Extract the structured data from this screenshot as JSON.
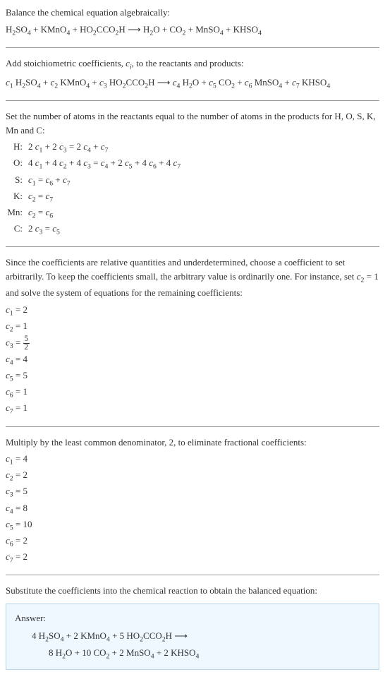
{
  "intro1": "Balance the chemical equation algebraically:",
  "eq1_a": "H",
  "eq1_b": "2",
  "eq1_c": "SO",
  "eq1_d": "4",
  "eq1_e": " + KMnO",
  "eq1_f": "4",
  "eq1_g": " + HO",
  "eq1_h": "2",
  "eq1_i": "CCO",
  "eq1_j": "2",
  "eq1_k": "H ",
  "eq1_arrow": "⟶",
  "eq1_l": " H",
  "eq1_m": "2",
  "eq1_n": "O + CO",
  "eq1_o": "2",
  "eq1_p": " + MnSO",
  "eq1_q": "4",
  "eq1_r": " + KHSO",
  "eq1_s": "4",
  "intro2a": "Add stoichiometric coefficients, ",
  "intro2b": "c",
  "intro2c": "i",
  "intro2d": ", to the reactants and products:",
  "eq2_a": "c",
  "eq2_b": "1",
  "eq2_c": " H",
  "eq2_d": "2",
  "eq2_e": "SO",
  "eq2_f": "4",
  "eq2_g": " + ",
  "eq2_h": "c",
  "eq2_i": "2",
  "eq2_j": " KMnO",
  "eq2_k": "4",
  "eq2_l": " + ",
  "eq2_m": "c",
  "eq2_n": "3",
  "eq2_o": " HO",
  "eq2_p": "2",
  "eq2_q": "CCO",
  "eq2_r": "2",
  "eq2_s": "H ",
  "eq2_arrow": "⟶",
  "eq2_t": " ",
  "eq2_u": "c",
  "eq2_v": "4",
  "eq2_w": " H",
  "eq2_x": "2",
  "eq2_y": "O + ",
  "eq2_z": "c",
  "eq2_aa": "5",
  "eq2_ab": " CO",
  "eq2_ac": "2",
  "eq2_ad": " + ",
  "eq2_ae": "c",
  "eq2_af": "6",
  "eq2_ag": " MnSO",
  "eq2_ah": "4",
  "eq2_ai": " + ",
  "eq2_aj": "c",
  "eq2_ak": "7",
  "eq2_al": " KHSO",
  "eq2_am": "4",
  "intro3": "Set the number of atoms in the reactants equal to the number of atoms in the products for H, O, S, K, Mn and C:",
  "atoms": [
    {
      "label": "H:",
      "c": "c",
      "s1": "1",
      "t1": " + 2 ",
      "s2": "3",
      "t2": " = 2 ",
      "s3": "4",
      "t3": " + ",
      "s4": "7",
      "eq_pre": "2 "
    },
    {
      "label": "O:",
      "c": "c",
      "s1": "1",
      "t1": " + 4 ",
      "s2": "2",
      "t2": " + 4 ",
      "s3": "3",
      "t3": " = ",
      "s4": "4",
      "t4": " + 2 ",
      "s5": "5",
      "t5": " + 4 ",
      "s6": "6",
      "t6": " + 4 ",
      "s7": "7",
      "eq_pre": "4 "
    },
    {
      "label": "S:",
      "c": "c",
      "s1": "1",
      "t1": " = ",
      "s2": "6",
      "t2": " + ",
      "s3": "7",
      "eq_pre": ""
    },
    {
      "label": "K:",
      "c": "c",
      "s1": "2",
      "t1": " = ",
      "s2": "7",
      "eq_pre": ""
    },
    {
      "label": "Mn:",
      "c": "c",
      "s1": "2",
      "t1": " = ",
      "s2": "6",
      "eq_pre": ""
    },
    {
      "label": "C:",
      "c": "c",
      "s1": "3",
      "t1": " = ",
      "s2": "5",
      "eq_pre": "2 "
    }
  ],
  "intro4a": "Since the coefficients are relative quantities and underdetermined, choose a coefficient to set arbitrarily. To keep the coefficients small, the arbitrary value is ordinarily one. For instance, set ",
  "intro4b": "c",
  "intro4c": "2",
  "intro4d": " = 1 and solve the system of equations for the remaining coefficients:",
  "coeffs1": [
    {
      "c": "c",
      "sub": "1",
      "val": " = 2"
    },
    {
      "c": "c",
      "sub": "2",
      "val": " = 1"
    },
    {
      "c": "c",
      "sub": "3",
      "frac_num": "5",
      "frac_den": "2",
      "val_pre": " = "
    },
    {
      "c": "c",
      "sub": "4",
      "val": " = 4"
    },
    {
      "c": "c",
      "sub": "5",
      "val": " = 5"
    },
    {
      "c": "c",
      "sub": "6",
      "val": " = 1"
    },
    {
      "c": "c",
      "sub": "7",
      "val": " = 1"
    }
  ],
  "intro5": "Multiply by the least common denominator, 2, to eliminate fractional coefficients:",
  "coeffs2": [
    {
      "c": "c",
      "sub": "1",
      "val": " = 4"
    },
    {
      "c": "c",
      "sub": "2",
      "val": " = 2"
    },
    {
      "c": "c",
      "sub": "3",
      "val": " = 5"
    },
    {
      "c": "c",
      "sub": "4",
      "val": " = 8"
    },
    {
      "c": "c",
      "sub": "5",
      "val": " = 10"
    },
    {
      "c": "c",
      "sub": "6",
      "val": " = 2"
    },
    {
      "c": "c",
      "sub": "7",
      "val": " = 2"
    }
  ],
  "intro6": "Substitute the coefficients into the chemical reaction to obtain the balanced equation:",
  "answer_label": "Answer:",
  "ans_a": "4 H",
  "ans_b": "2",
  "ans_c": "SO",
  "ans_d": "4",
  "ans_e": " + 2 KMnO",
  "ans_f": "4",
  "ans_g": " + 5 HO",
  "ans_h": "2",
  "ans_i": "CCO",
  "ans_j": "2",
  "ans_k": "H ",
  "ans_arrow": "⟶",
  "ans_l": "8 H",
  "ans_m": "2",
  "ans_n": "O + 10 CO",
  "ans_o": "2",
  "ans_p": " + 2 MnSO",
  "ans_q": "4",
  "ans_r": " + 2 KHSO",
  "ans_s": "4"
}
